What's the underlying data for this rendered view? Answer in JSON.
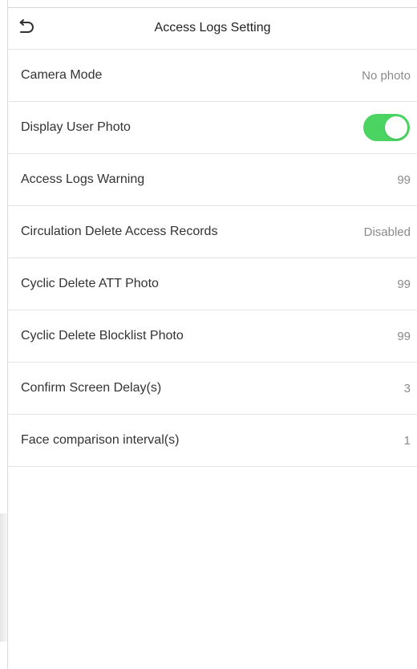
{
  "header": {
    "title": "Access Logs Setting",
    "back_icon": "undo-arrow-icon"
  },
  "rows": [
    {
      "label": "Camera Mode",
      "value": "No photo"
    },
    {
      "label": "Display User Photo",
      "toggle": true
    },
    {
      "label": "Access Logs Warning",
      "value": "99"
    },
    {
      "label": "Circulation Delete Access Records",
      "value": "Disabled"
    },
    {
      "label": "Cyclic Delete ATT Photo",
      "value": "99"
    },
    {
      "label": "Cyclic Delete Blocklist Photo",
      "value": "99"
    },
    {
      "label": "Confirm Screen Delay(s)",
      "value": "3"
    },
    {
      "label": "Face comparison interval(s)",
      "value": "1"
    }
  ],
  "colors": {
    "toggle_on": "#4cd463",
    "divider": "#e3e3e3",
    "value_text": "#8a8a8a"
  }
}
